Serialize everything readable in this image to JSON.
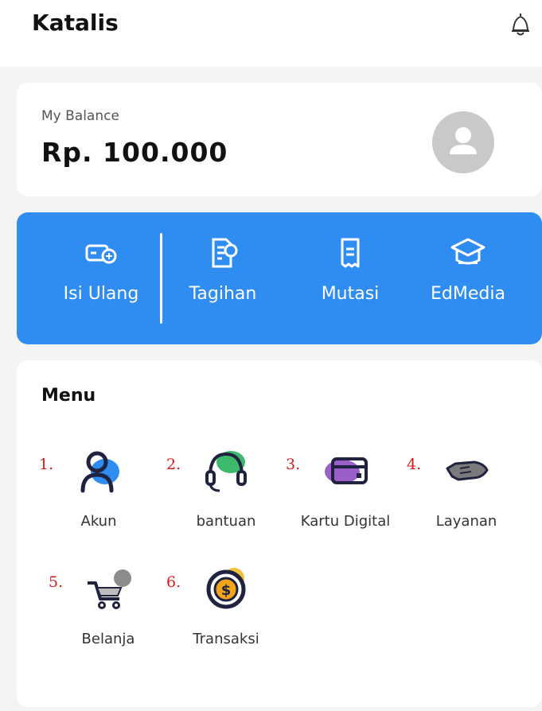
{
  "header": {
    "title": "Katalis",
    "icons": [
      "bell-icon"
    ]
  },
  "balance": {
    "label": "My Balance",
    "amount": "Rp. 100.000"
  },
  "actions": [
    {
      "label": "Isi Ulang",
      "icon": "wallet-add-icon"
    },
    {
      "label": "Tagihan",
      "icon": "bill-icon"
    },
    {
      "label": "Mutasi",
      "icon": "receipt-icon"
    },
    {
      "label": "EdMedia",
      "icon": "graduation-cap-icon"
    }
  ],
  "menu": {
    "title": "Menu",
    "items": [
      {
        "num": "1.",
        "label": "Akun",
        "icon": "user-icon"
      },
      {
        "num": "2.",
        "label": "bantuan",
        "icon": "headset-icon"
      },
      {
        "num": "3.",
        "label": "Kartu Digital",
        "icon": "card-icon"
      },
      {
        "num": "4.",
        "label": "Layanan",
        "icon": "hand-icon"
      },
      {
        "num": "5.",
        "label": "Belanja",
        "icon": "cart-icon"
      },
      {
        "num": "6.",
        "label": "Transaksi",
        "icon": "coin-icon"
      }
    ]
  },
  "colors": {
    "primary": "#2f8cf0",
    "annotation": "#e01818",
    "background": "#f4f4f4",
    "card": "#ffffff"
  }
}
